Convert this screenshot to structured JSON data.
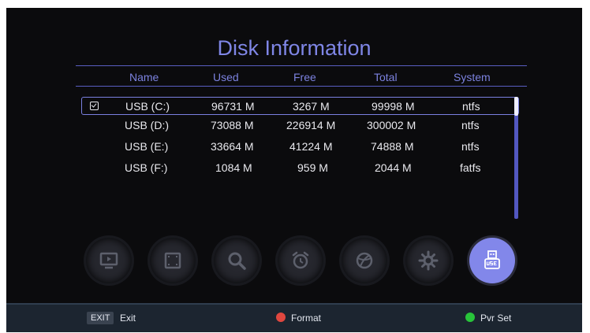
{
  "title": "Disk Information",
  "columns": [
    "Name",
    "Used",
    "Free",
    "Total",
    "System"
  ],
  "disks": [
    {
      "name": "USB (C:)",
      "used": "96731 M",
      "free": "3267 M",
      "total": "99998 M",
      "system": "ntfs"
    },
    {
      "name": "USB (D:)",
      "used": "73088 M",
      "free": "226914 M",
      "total": "300002 M",
      "system": "ntfs"
    },
    {
      "name": "USB (E:)",
      "used": "33664 M",
      "free": "41224 M",
      "total": "74888 M",
      "system": "ntfs"
    },
    {
      "name": "USB (F:)",
      "used": "1084 M",
      "free": "959 M",
      "total": "2044 M",
      "system": "fatfs"
    }
  ],
  "menu_icons": [
    "tv-icon",
    "picture-icon",
    "search-icon",
    "alarm-clock-icon",
    "globe-icon",
    "gear-icon",
    "usb-icon"
  ],
  "active_menu_icon": "usb-icon",
  "footer": {
    "exit_key": "EXIT",
    "exit_label": "Exit",
    "format_label": "Format",
    "pvr_label": "Pvr Set"
  },
  "colors": {
    "accent": "#7f86e6",
    "red_button": "#e0473f",
    "green_button": "#28c43a"
  }
}
